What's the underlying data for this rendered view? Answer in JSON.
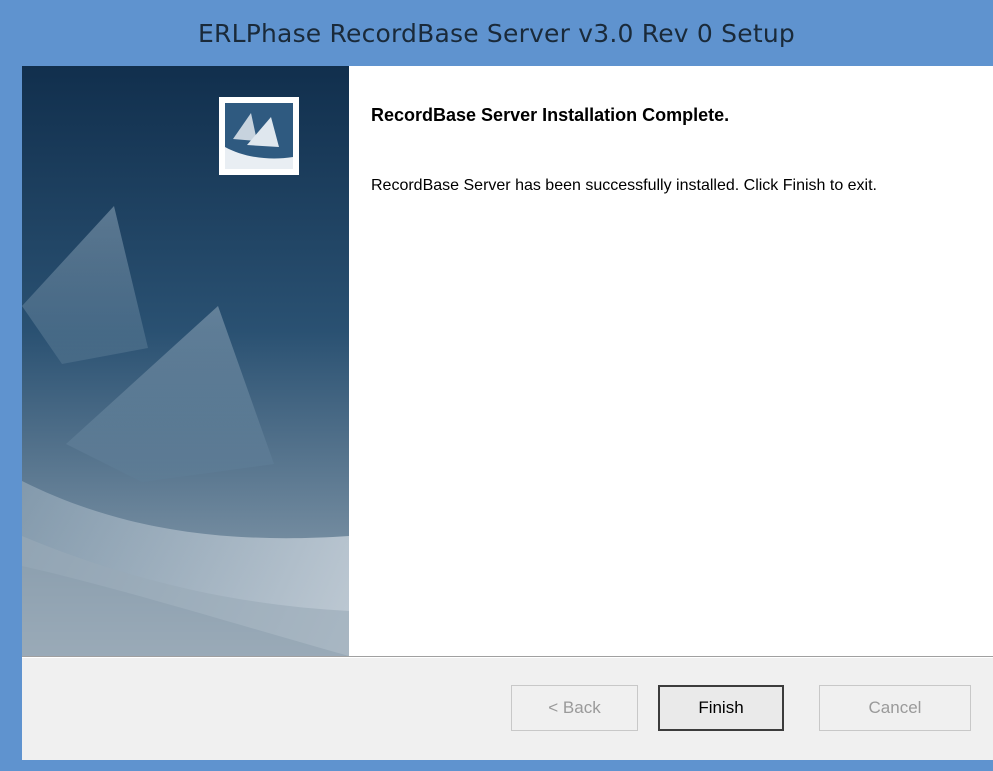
{
  "window": {
    "title": "ERLPhase RecordBase Server v3.0 Rev 0 Setup"
  },
  "content": {
    "heading": "RecordBase Server Installation Complete.",
    "message": "RecordBase Server has been successfully installed.  Click Finish to exit."
  },
  "footer": {
    "back_label": "< Back",
    "finish_label": "Finish",
    "cancel_label": "Cancel"
  },
  "colors": {
    "titlebar": "#5f93cf",
    "side_dark": "#1b3d5c",
    "side_light": "#9aaab8"
  }
}
